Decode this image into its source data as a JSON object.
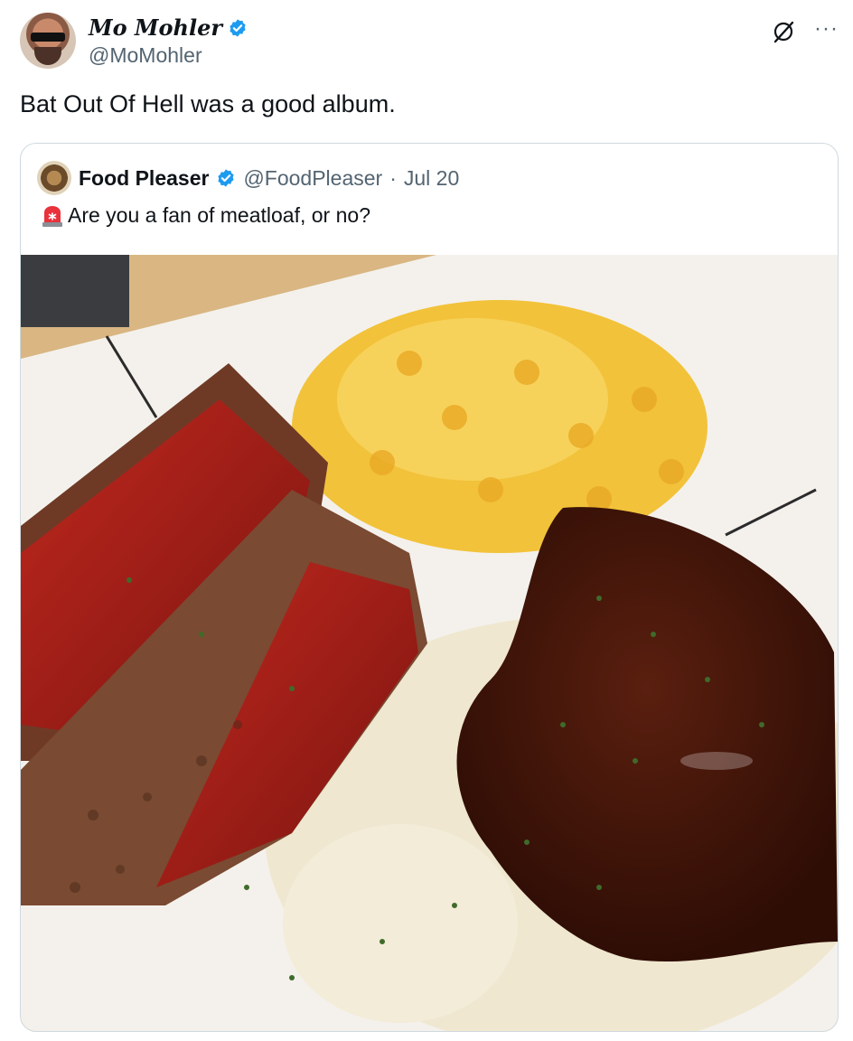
{
  "post": {
    "display_name": "Mo Mohler",
    "handle": "@MoMohler",
    "text": "Bat Out Of Hell was a good album.",
    "icons": {
      "verified": "verified-badge-icon",
      "grok": "grok-icon",
      "more": "more-icon"
    },
    "more_label": "···"
  },
  "quote": {
    "display_name": "Food Pleaser",
    "handle": "@FoodPleaser",
    "separator": "·",
    "date": "Jul 20",
    "text": "Are you a fan of meatloaf, or no?",
    "icons": {
      "siren": "siren-emoji-icon",
      "verified": "verified-badge-icon"
    }
  },
  "colors": {
    "verified_blue": "#1d9bf0",
    "secondary_text": "#536471",
    "border": "#cfd9de"
  }
}
